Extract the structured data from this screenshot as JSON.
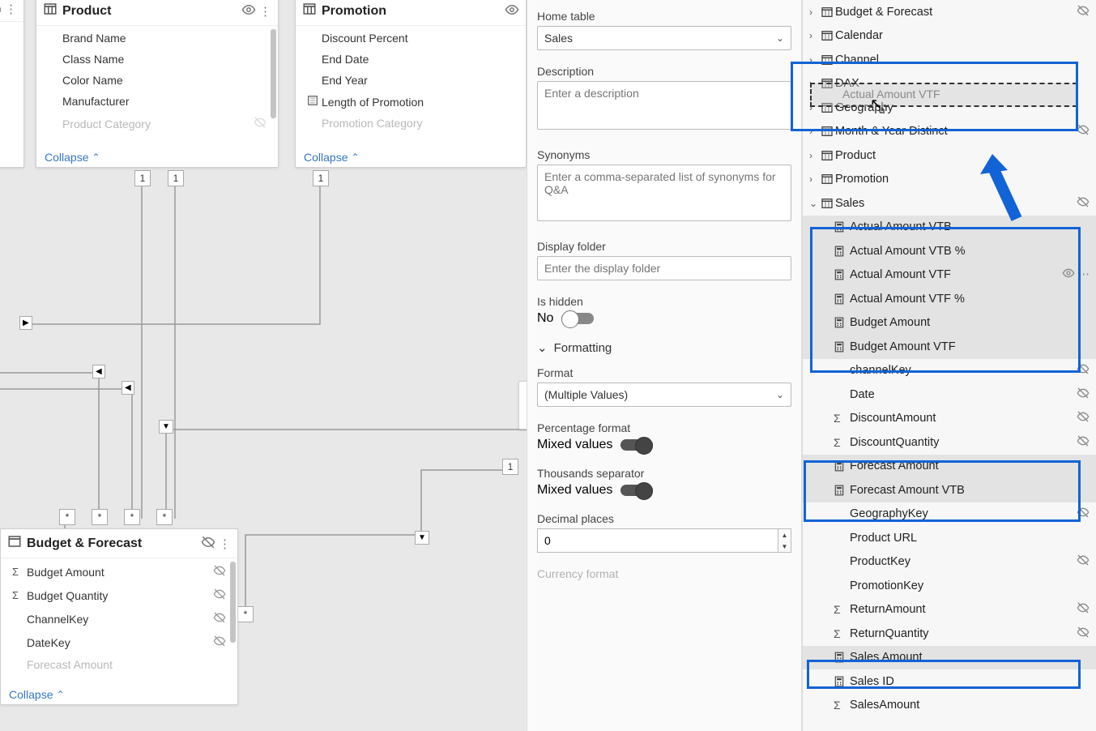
{
  "diagram": {
    "product": {
      "title": "Product",
      "fields": [
        "Brand Name",
        "Class Name",
        "Color Name",
        "Manufacturer",
        "Product Category"
      ]
    },
    "promotion": {
      "title": "Promotion",
      "fields": [
        "Discount Percent",
        "End Date",
        "End Year",
        "Length of Promotion",
        "Promotion Category"
      ]
    },
    "budget": {
      "title": "Budget & Forecast",
      "fields": [
        "Budget Amount",
        "Budget Quantity",
        "ChannelKey",
        "DateKey",
        "Forecast Amount"
      ]
    },
    "collapse": "Collapse"
  },
  "labels": {
    "one": "1",
    "many": "*"
  },
  "props": {
    "home_table_label": "Home table",
    "home_table_value": "Sales",
    "description_label": "Description",
    "description_ph": "Enter a description",
    "synonyms_label": "Synonyms",
    "synonyms_ph": "Enter a comma-separated list of synonyms for Q&A",
    "display_folder_label": "Display folder",
    "display_folder_ph": "Enter the display folder",
    "is_hidden_label": "Is hidden",
    "is_hidden_value": "No",
    "formatting_label": "Formatting",
    "format_label": "Format",
    "format_value": "(Multiple Values)",
    "percentage_label": "Percentage format",
    "percentage_value": "Mixed values",
    "thousands_label": "Thousands separator",
    "thousands_value": "Mixed values",
    "decimal_label": "Decimal places",
    "decimal_value": "0",
    "currency_label": "Currency format"
  },
  "tree": {
    "tables": [
      {
        "name": "Budget & Forecast",
        "hidden": true
      },
      {
        "name": "Calendar"
      },
      {
        "name": "Channel"
      },
      {
        "name": "DAX",
        "drag": "Actual Amount VTF"
      },
      {
        "name": "Geography"
      },
      {
        "name": "Month & Year Distinct",
        "hidden": true
      },
      {
        "name": "Product"
      },
      {
        "name": "Promotion"
      },
      {
        "name": "Sales",
        "expanded": true,
        "hidden": true
      }
    ],
    "sales_children": [
      {
        "name": "Actual Amount VTB",
        "type": "calc",
        "sel": true
      },
      {
        "name": "Actual Amount VTB %",
        "type": "calc",
        "sel": true
      },
      {
        "name": "Actual Amount VTF",
        "type": "calc",
        "sel": true,
        "eye": true,
        "more": true
      },
      {
        "name": "Actual Amount VTF %",
        "type": "calc",
        "sel": true
      },
      {
        "name": "Budget Amount",
        "type": "calc",
        "sel": true
      },
      {
        "name": "Budget Amount VTF",
        "type": "calc",
        "sel": true
      },
      {
        "name": "channelKey",
        "type": "field",
        "hidden": true
      },
      {
        "name": "Date",
        "type": "field",
        "hidden": true
      },
      {
        "name": "DiscountAmount",
        "type": "sum",
        "hidden": true
      },
      {
        "name": "DiscountQuantity",
        "type": "sum",
        "hidden": true
      },
      {
        "name": "Forecast Amount",
        "type": "calc",
        "sel": true
      },
      {
        "name": "Forecast Amount VTB",
        "type": "calc",
        "sel": true
      },
      {
        "name": "GeographyKey",
        "type": "field",
        "hidden": true
      },
      {
        "name": "Product URL",
        "type": "field"
      },
      {
        "name": "ProductKey",
        "type": "field",
        "hidden": true
      },
      {
        "name": "PromotionKey",
        "type": "field"
      },
      {
        "name": "ReturnAmount",
        "type": "sum",
        "hidden": true
      },
      {
        "name": "ReturnQuantity",
        "type": "sum",
        "hidden": true
      },
      {
        "name": "Sales Amount",
        "type": "calc",
        "sel": true
      },
      {
        "name": "Sales ID",
        "type": "calc"
      },
      {
        "name": "SalesAmount",
        "type": "sum"
      }
    ]
  }
}
